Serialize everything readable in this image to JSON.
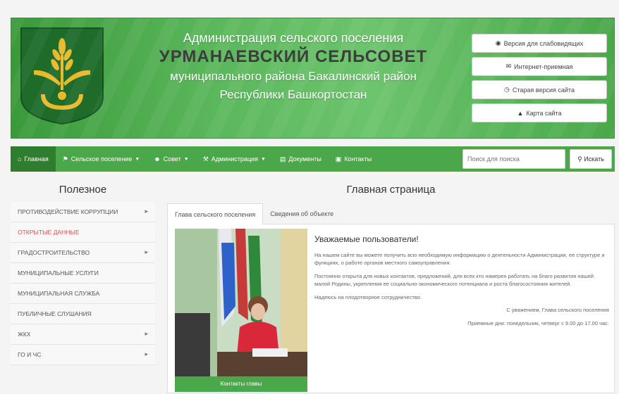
{
  "header": {
    "line1": "Администрация сельского поселения",
    "line2": "УРМАНАЕВСКИЙ СЕЛЬСОВЕТ",
    "line3": "муниципального района Бакалинский район",
    "line4": "Республики Башкортостан",
    "buttons": [
      {
        "icon": "eye-icon",
        "label": "Версия для слабовидящих"
      },
      {
        "icon": "mail-icon",
        "label": "Интернет-приемная"
      },
      {
        "icon": "clock-icon",
        "label": "Старая версия сайта"
      },
      {
        "icon": "sitemap-icon",
        "label": "Карта сайта"
      }
    ]
  },
  "nav": {
    "items": [
      {
        "icon": "home-icon",
        "label": "Главная",
        "caret": false
      },
      {
        "icon": "flag-icon",
        "label": "Сельское поселение",
        "caret": true
      },
      {
        "icon": "users-icon",
        "label": "Совет",
        "caret": true
      },
      {
        "icon": "building-icon",
        "label": "Администрация",
        "caret": true
      },
      {
        "icon": "document-icon",
        "label": "Документы",
        "caret": false
      },
      {
        "icon": "contacts-icon",
        "label": "Контакты",
        "caret": false
      }
    ],
    "search_placeholder": "Поиск для поиска",
    "search_button": "Искать"
  },
  "sidebar": {
    "title": "Полезное",
    "items": [
      {
        "label": "Противодействие коррупции",
        "arrow": true,
        "red": false
      },
      {
        "label": "Открытые данные",
        "arrow": false,
        "red": true
      },
      {
        "label": "Градостроительство",
        "arrow": true,
        "red": false
      },
      {
        "label": "Муниципальные услуги",
        "arrow": false,
        "red": false
      },
      {
        "label": "Муниципальная служба",
        "arrow": false,
        "red": false
      },
      {
        "label": "Публичные слушания",
        "arrow": false,
        "red": false
      },
      {
        "label": "ЖКХ",
        "arrow": true,
        "red": false
      },
      {
        "label": "ГО и ЧС",
        "arrow": true,
        "red": false
      }
    ]
  },
  "main": {
    "title": "Главная страница",
    "tabs": [
      "Глава сельского поселения",
      "Сведения об объекте"
    ],
    "photo_button": "Контакты главы",
    "greeting": "Уважаемые пользователи!",
    "paragraph1": "На нашем сайте вы можете получить всю необходимую информацию о деятельности Администрации, ее структуре и функциях, о работе органов местного самоуправления.",
    "paragraph2": "Постоянно открыта для новых контактов, предложений, для всех кто намерен работать на благо развития нашей малой Родины, укрепления ее социально-экономического потенциала и роста благосостояния жителей.",
    "paragraph3": "Надеюсь на плодотворное сотрудничество.",
    "signature": "С уважением, Глава сельского поселения",
    "hours": "Приемные дни: понедельник, четверг с 9.00 до 17.00 час."
  },
  "colors": {
    "brand_green": "#4aa84a",
    "nav_active": "#2f7d2f"
  }
}
